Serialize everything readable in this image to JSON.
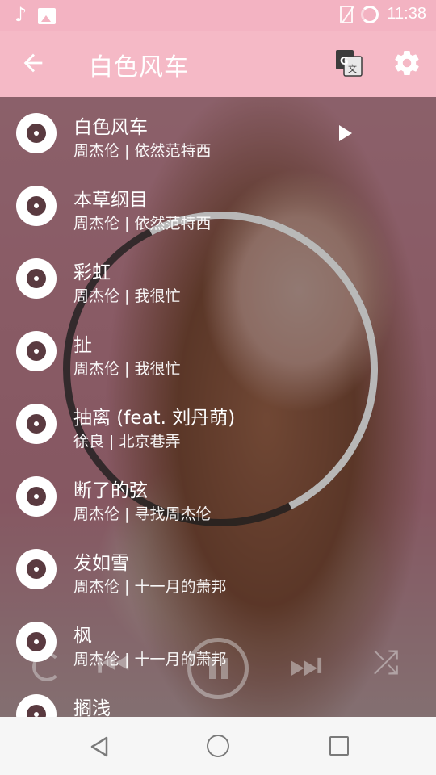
{
  "status_bar": {
    "time": "11:38",
    "left_icons": [
      "music-note-icon",
      "image-icon"
    ],
    "right_icons": [
      "no-sim-icon",
      "battery-icon"
    ]
  },
  "app_bar": {
    "title": "白色风车",
    "back_icon": "back-arrow-icon",
    "actions": [
      "translate-icon",
      "settings-icon"
    ]
  },
  "songs": [
    {
      "title": "白色风车",
      "meta": "周杰伦 | 依然范特西",
      "playing": true
    },
    {
      "title": "本草纲目",
      "meta": "周杰伦 | 依然范特西"
    },
    {
      "title": "彩虹",
      "meta": "周杰伦 | 我很忙"
    },
    {
      "title": "扯",
      "meta": "周杰伦 | 我很忙"
    },
    {
      "title": "抽离 (feat. 刘丹萌)",
      "meta": "徐良 | 北京巷弄"
    },
    {
      "title": "断了的弦",
      "meta": "周杰伦 | 寻找周杰伦"
    },
    {
      "title": "发如雪",
      "meta": "周杰伦 | 十一月的萧邦"
    },
    {
      "title": "枫",
      "meta": "周杰伦 | 十一月的萧邦"
    },
    {
      "title": "搁浅",
      "meta": ""
    }
  ],
  "player_controls": [
    "repeat-icon",
    "previous-icon",
    "pause-icon",
    "next-icon",
    "shuffle-icon"
  ],
  "nav_bar": [
    "nav-back-icon",
    "nav-home-icon",
    "nav-recents-icon"
  ],
  "colors": {
    "app_bar": "#f5b9c6",
    "status_bar": "#f3b3c2",
    "nav_bar": "#f6f6f6"
  }
}
